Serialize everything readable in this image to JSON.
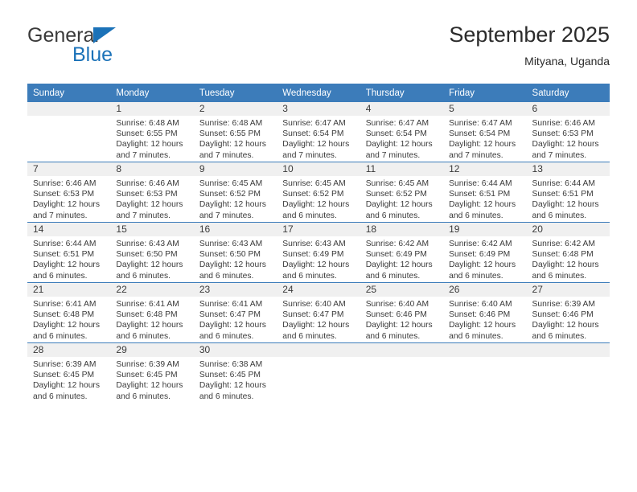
{
  "brand": {
    "name_top": "General",
    "name_bottom": "Blue",
    "triangle_color": "#1b72b8"
  },
  "header": {
    "title": "September 2025",
    "subtitle": "Mityana, Uganda"
  },
  "theme": {
    "header_bg": "#3c7cba",
    "header_text": "#ffffff",
    "daynum_bg": "#f0f0f0",
    "row_divider": "#3c7cba",
    "body_text": "#3a3a3a"
  },
  "weekday_headers": [
    "Sunday",
    "Monday",
    "Tuesday",
    "Wednesday",
    "Thursday",
    "Friday",
    "Saturday"
  ],
  "weeks": [
    [
      {
        "day": "",
        "sunrise": "",
        "sunset": "",
        "daylight": "",
        "daylight2": "",
        "blank": true
      },
      {
        "day": "1",
        "sunrise": "Sunrise: 6:48 AM",
        "sunset": "Sunset: 6:55 PM",
        "daylight": "Daylight: 12 hours",
        "daylight2": "and 7 minutes."
      },
      {
        "day": "2",
        "sunrise": "Sunrise: 6:48 AM",
        "sunset": "Sunset: 6:55 PM",
        "daylight": "Daylight: 12 hours",
        "daylight2": "and 7 minutes."
      },
      {
        "day": "3",
        "sunrise": "Sunrise: 6:47 AM",
        "sunset": "Sunset: 6:54 PM",
        "daylight": "Daylight: 12 hours",
        "daylight2": "and 7 minutes."
      },
      {
        "day": "4",
        "sunrise": "Sunrise: 6:47 AM",
        "sunset": "Sunset: 6:54 PM",
        "daylight": "Daylight: 12 hours",
        "daylight2": "and 7 minutes."
      },
      {
        "day": "5",
        "sunrise": "Sunrise: 6:47 AM",
        "sunset": "Sunset: 6:54 PM",
        "daylight": "Daylight: 12 hours",
        "daylight2": "and 7 minutes."
      },
      {
        "day": "6",
        "sunrise": "Sunrise: 6:46 AM",
        "sunset": "Sunset: 6:53 PM",
        "daylight": "Daylight: 12 hours",
        "daylight2": "and 7 minutes."
      }
    ],
    [
      {
        "day": "7",
        "sunrise": "Sunrise: 6:46 AM",
        "sunset": "Sunset: 6:53 PM",
        "daylight": "Daylight: 12 hours",
        "daylight2": "and 7 minutes."
      },
      {
        "day": "8",
        "sunrise": "Sunrise: 6:46 AM",
        "sunset": "Sunset: 6:53 PM",
        "daylight": "Daylight: 12 hours",
        "daylight2": "and 7 minutes."
      },
      {
        "day": "9",
        "sunrise": "Sunrise: 6:45 AM",
        "sunset": "Sunset: 6:52 PM",
        "daylight": "Daylight: 12 hours",
        "daylight2": "and 7 minutes."
      },
      {
        "day": "10",
        "sunrise": "Sunrise: 6:45 AM",
        "sunset": "Sunset: 6:52 PM",
        "daylight": "Daylight: 12 hours",
        "daylight2": "and 6 minutes."
      },
      {
        "day": "11",
        "sunrise": "Sunrise: 6:45 AM",
        "sunset": "Sunset: 6:52 PM",
        "daylight": "Daylight: 12 hours",
        "daylight2": "and 6 minutes."
      },
      {
        "day": "12",
        "sunrise": "Sunrise: 6:44 AM",
        "sunset": "Sunset: 6:51 PM",
        "daylight": "Daylight: 12 hours",
        "daylight2": "and 6 minutes."
      },
      {
        "day": "13",
        "sunrise": "Sunrise: 6:44 AM",
        "sunset": "Sunset: 6:51 PM",
        "daylight": "Daylight: 12 hours",
        "daylight2": "and 6 minutes."
      }
    ],
    [
      {
        "day": "14",
        "sunrise": "Sunrise: 6:44 AM",
        "sunset": "Sunset: 6:51 PM",
        "daylight": "Daylight: 12 hours",
        "daylight2": "and 6 minutes."
      },
      {
        "day": "15",
        "sunrise": "Sunrise: 6:43 AM",
        "sunset": "Sunset: 6:50 PM",
        "daylight": "Daylight: 12 hours",
        "daylight2": "and 6 minutes."
      },
      {
        "day": "16",
        "sunrise": "Sunrise: 6:43 AM",
        "sunset": "Sunset: 6:50 PM",
        "daylight": "Daylight: 12 hours",
        "daylight2": "and 6 minutes."
      },
      {
        "day": "17",
        "sunrise": "Sunrise: 6:43 AM",
        "sunset": "Sunset: 6:49 PM",
        "daylight": "Daylight: 12 hours",
        "daylight2": "and 6 minutes."
      },
      {
        "day": "18",
        "sunrise": "Sunrise: 6:42 AM",
        "sunset": "Sunset: 6:49 PM",
        "daylight": "Daylight: 12 hours",
        "daylight2": "and 6 minutes."
      },
      {
        "day": "19",
        "sunrise": "Sunrise: 6:42 AM",
        "sunset": "Sunset: 6:49 PM",
        "daylight": "Daylight: 12 hours",
        "daylight2": "and 6 minutes."
      },
      {
        "day": "20",
        "sunrise": "Sunrise: 6:42 AM",
        "sunset": "Sunset: 6:48 PM",
        "daylight": "Daylight: 12 hours",
        "daylight2": "and 6 minutes."
      }
    ],
    [
      {
        "day": "21",
        "sunrise": "Sunrise: 6:41 AM",
        "sunset": "Sunset: 6:48 PM",
        "daylight": "Daylight: 12 hours",
        "daylight2": "and 6 minutes."
      },
      {
        "day": "22",
        "sunrise": "Sunrise: 6:41 AM",
        "sunset": "Sunset: 6:48 PM",
        "daylight": "Daylight: 12 hours",
        "daylight2": "and 6 minutes."
      },
      {
        "day": "23",
        "sunrise": "Sunrise: 6:41 AM",
        "sunset": "Sunset: 6:47 PM",
        "daylight": "Daylight: 12 hours",
        "daylight2": "and 6 minutes."
      },
      {
        "day": "24",
        "sunrise": "Sunrise: 6:40 AM",
        "sunset": "Sunset: 6:47 PM",
        "daylight": "Daylight: 12 hours",
        "daylight2": "and 6 minutes."
      },
      {
        "day": "25",
        "sunrise": "Sunrise: 6:40 AM",
        "sunset": "Sunset: 6:46 PM",
        "daylight": "Daylight: 12 hours",
        "daylight2": "and 6 minutes."
      },
      {
        "day": "26",
        "sunrise": "Sunrise: 6:40 AM",
        "sunset": "Sunset: 6:46 PM",
        "daylight": "Daylight: 12 hours",
        "daylight2": "and 6 minutes."
      },
      {
        "day": "27",
        "sunrise": "Sunrise: 6:39 AM",
        "sunset": "Sunset: 6:46 PM",
        "daylight": "Daylight: 12 hours",
        "daylight2": "and 6 minutes."
      }
    ],
    [
      {
        "day": "28",
        "sunrise": "Sunrise: 6:39 AM",
        "sunset": "Sunset: 6:45 PM",
        "daylight": "Daylight: 12 hours",
        "daylight2": "and 6 minutes."
      },
      {
        "day": "29",
        "sunrise": "Sunrise: 6:39 AM",
        "sunset": "Sunset: 6:45 PM",
        "daylight": "Daylight: 12 hours",
        "daylight2": "and 6 minutes."
      },
      {
        "day": "30",
        "sunrise": "Sunrise: 6:38 AM",
        "sunset": "Sunset: 6:45 PM",
        "daylight": "Daylight: 12 hours",
        "daylight2": "and 6 minutes."
      },
      {
        "day": "",
        "sunrise": "",
        "sunset": "",
        "daylight": "",
        "daylight2": "",
        "blank": true
      },
      {
        "day": "",
        "sunrise": "",
        "sunset": "",
        "daylight": "",
        "daylight2": "",
        "blank": true
      },
      {
        "day": "",
        "sunrise": "",
        "sunset": "",
        "daylight": "",
        "daylight2": "",
        "blank": true
      },
      {
        "day": "",
        "sunrise": "",
        "sunset": "",
        "daylight": "",
        "daylight2": "",
        "blank": true
      }
    ]
  ]
}
